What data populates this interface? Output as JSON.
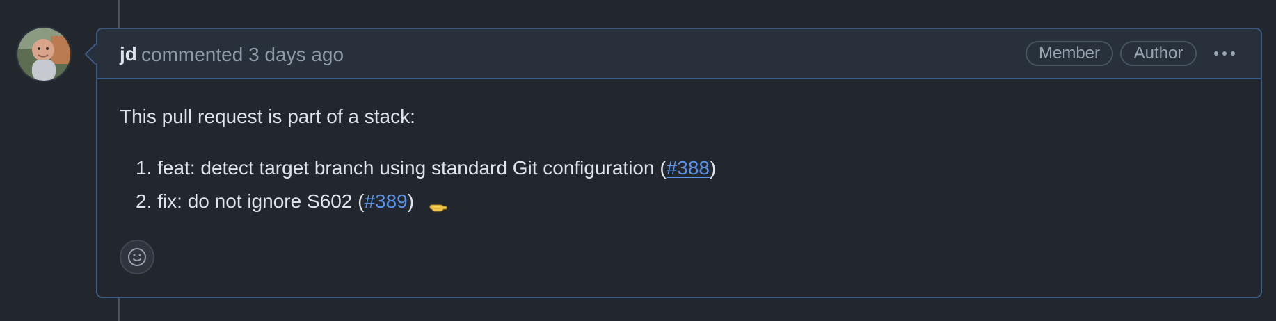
{
  "comment": {
    "author": "jd",
    "meta": "commented 3 days ago",
    "badges": [
      "Member",
      "Author"
    ],
    "menu_icon": "kebab-horizontal-icon",
    "body_intro": "This pull request is part of a stack:",
    "items": [
      {
        "number": "1.",
        "text": "feat: detect target branch using standard Git configuration (",
        "link": "#388",
        "suffix": ")"
      },
      {
        "number": "2.",
        "text": "fix: do not ignore S602 (",
        "link": "#389",
        "suffix": ")",
        "emoji_icon": "backhand-index-pointing-left-icon"
      }
    ]
  },
  "colors": {
    "background": "#22262d",
    "header": "#28303c",
    "border": "#3f5b85",
    "link": "#5b93ea",
    "muted": "#8f99a8"
  },
  "icons": {
    "avatar": "avatar-photo-icon",
    "reaction": "smiley-face-icon"
  }
}
